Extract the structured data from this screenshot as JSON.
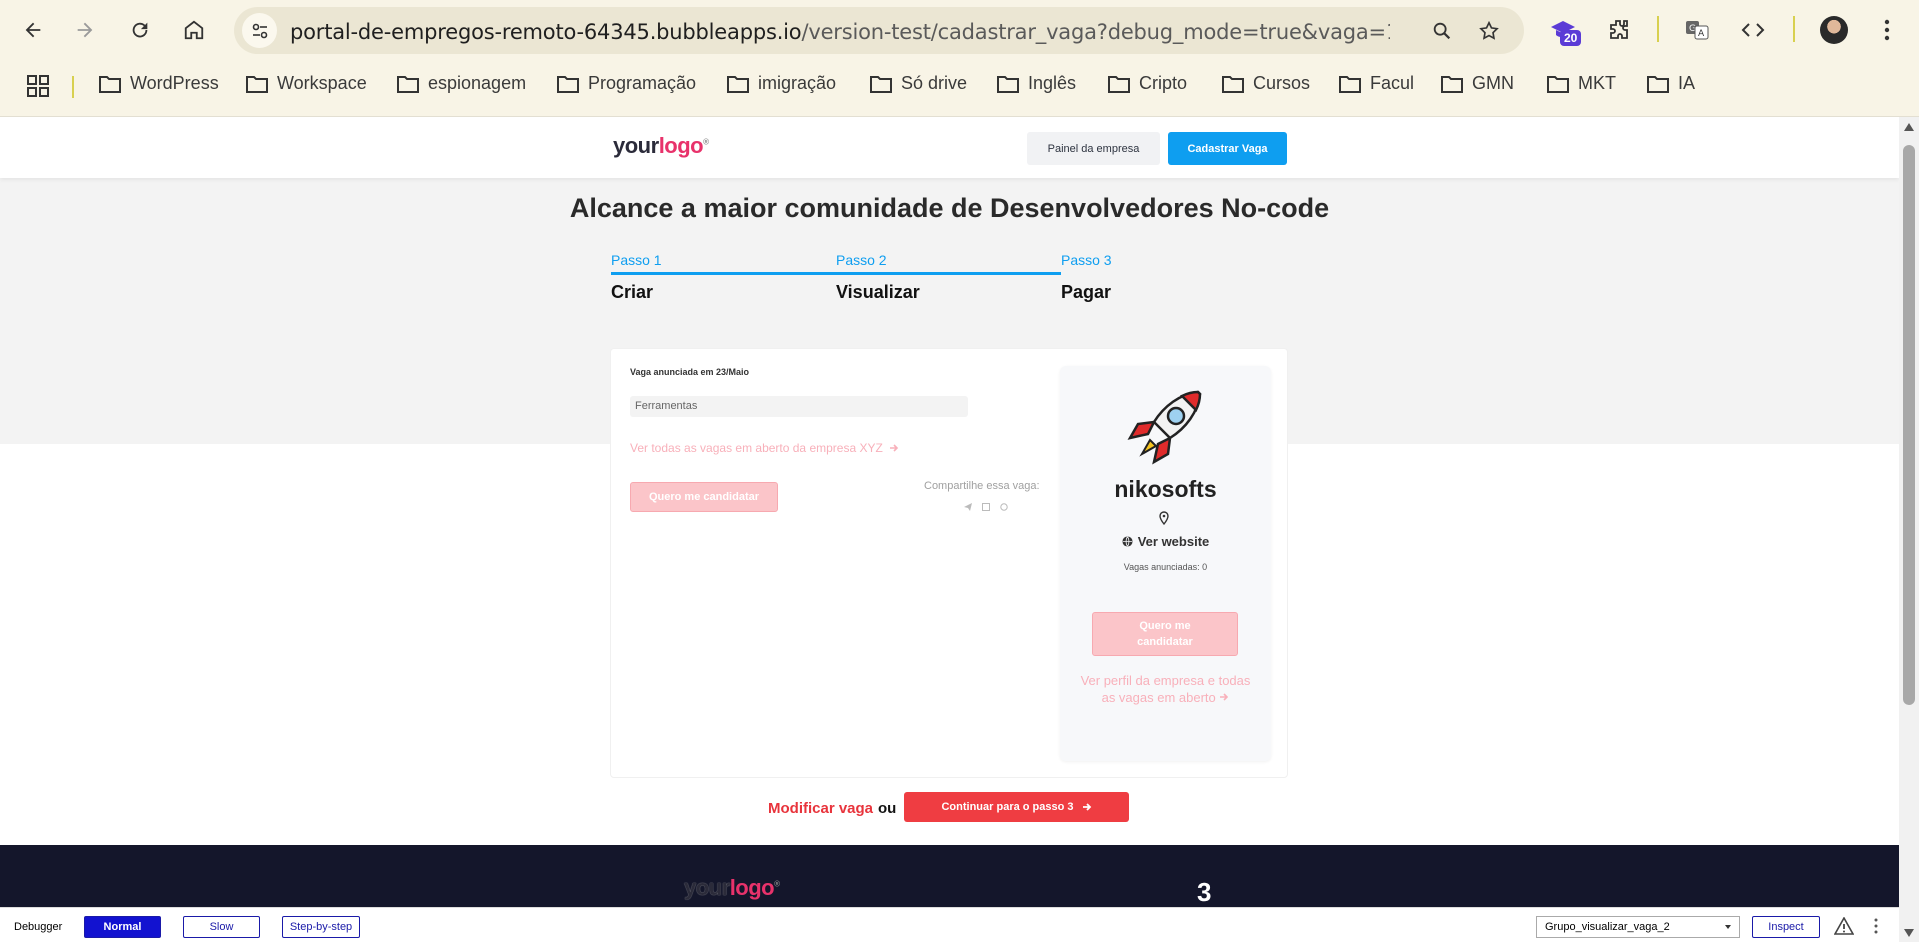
{
  "browser": {
    "url_host": "portal-de-empregos-remoto-64345.bubbleapps.io",
    "url_path": "/version-test/cadastrar_vaga?debug_mode=true&vaga=1748018718...",
    "extension_badge": "20",
    "bookmarks": [
      "WordPress",
      "Workspace",
      "espionagem",
      "Programação",
      "imigração",
      "Só drive",
      "Inglês",
      "Cripto",
      "Cursos",
      "Facul",
      "GMN",
      "MKT",
      "IA"
    ]
  },
  "header": {
    "logo_your": "your",
    "logo_logo": "logo",
    "company_panel": "Painel da empresa",
    "post_job": "Cadastrar Vaga"
  },
  "hero": {
    "title": "Alcance a maior comunidade de Desenvolvedores No-code",
    "steps": [
      {
        "num": "Passo 1",
        "name": "Criar"
      },
      {
        "num": "Passo 2",
        "name": "Visualizar"
      },
      {
        "num": "Passo 3",
        "name": "Pagar"
      }
    ]
  },
  "job": {
    "posted": "Vaga anunciada em 23/Maio",
    "tools": "Ferramentas",
    "all_jobs_link": "Ver todas as vagas em aberto da empresa XYZ",
    "apply": "Quero me candidatar",
    "share": "Compartilhe essa vaga:"
  },
  "company": {
    "name": "nikosofts",
    "website": "Ver website",
    "jobs_count": "Vagas anunciadas: 0",
    "apply": "Quero me candidatar",
    "profile_link": "Ver perfil da empresa e todas as vagas em aberto"
  },
  "actions": {
    "modify": "Modificar vaga",
    "or": "ou",
    "continue": "Continuar para o passo 3"
  },
  "footer": {
    "number": "3"
  },
  "debugger": {
    "label": "Debugger",
    "normal": "Normal",
    "slow": "Slow",
    "step": "Step-by-step",
    "element": "Grupo_visualizar_vaga_2",
    "inspect": "Inspect"
  }
}
